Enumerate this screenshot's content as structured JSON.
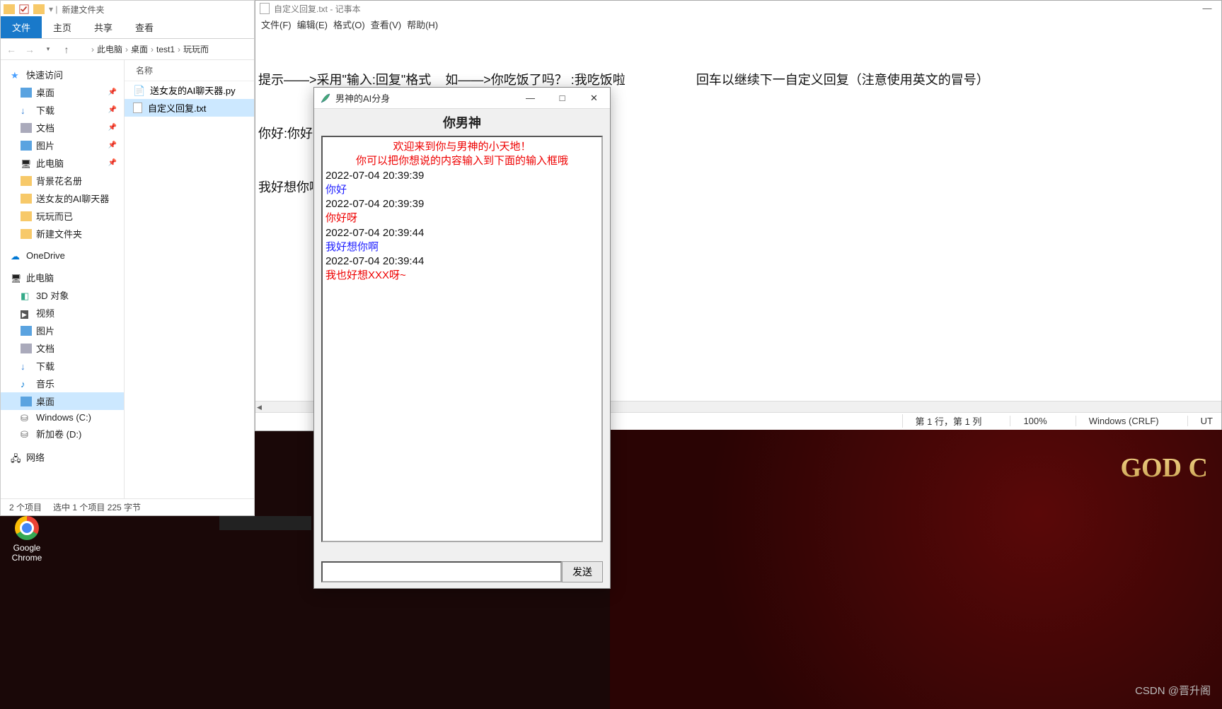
{
  "explorer": {
    "title": "新建文件夹",
    "tabs": {
      "file": "文件",
      "home": "主页",
      "share": "共享",
      "view": "查看"
    },
    "breadcrumb": [
      "此电脑",
      "桌面",
      "test1",
      "玩玩而"
    ],
    "columnHeader": "名称",
    "nav": {
      "quickAccess": "快速访问",
      "desktop": "桌面",
      "downloads": "下载",
      "documents": "文档",
      "pictures": "图片",
      "thisPC_pinned": "此电脑",
      "folder1": "背景花名册",
      "folder2": "送女友的AI聊天器",
      "folder3": "玩玩而已",
      "folder4": "新建文件夹",
      "onedrive": "OneDrive",
      "thisPC": "此电脑",
      "obj3d": "3D 对象",
      "videos": "视频",
      "pictures2": "图片",
      "documents2": "文档",
      "downloads2": "下载",
      "music": "音乐",
      "desktop2": "桌面",
      "driveC": "Windows (C:)",
      "driveD": "新加卷 (D:)",
      "network": "网络"
    },
    "files": [
      {
        "name": "送女友的AI聊天器.py",
        "icon": "py"
      },
      {
        "name": "自定义回复.txt",
        "icon": "txt",
        "selected": true
      }
    ],
    "status": {
      "count": "2 个项目",
      "selection": "选中 1 个项目  225 字节"
    }
  },
  "notepad": {
    "title": "自定义回复.txt - 记事本",
    "menu": {
      "file": "文件(F)",
      "edit": "编辑(E)",
      "format": "格式(O)",
      "view": "查看(V)",
      "help": "帮助(H)"
    },
    "lines": {
      "l1a": "提示——>采用\"输入:回复\"格式    如——>你吃饭了吗？ :我吃饭啦",
      "l1b": "回车以继续下一自定义回复（注意使用英文的冒号）",
      "l2": "你好:你好呀",
      "l3": "我好想你啊:我也好想XXX呀~"
    },
    "status": {
      "pos": "第 1 行，第 1 列",
      "zoom": "100%",
      "eol": "Windows (CRLF)",
      "enc": "UT"
    }
  },
  "tkapp": {
    "title": "男神的AI分身",
    "heading": "你男神",
    "welcome1": "欢迎来到你与男神的小天地！",
    "welcome2": "你可以把你想说的内容输入到下面的输入框哦",
    "messages": [
      {
        "ts": "2022-07-04 20:39:39",
        "who": "user",
        "text": "你好"
      },
      {
        "ts": "2022-07-04 20:39:39",
        "who": "bot",
        "text": "你好呀"
      },
      {
        "ts": "2022-07-04 20:39:44",
        "who": "user",
        "text": "我好想你啊"
      },
      {
        "ts": "2022-07-04 20:39:44",
        "who": "bot",
        "text": "我也好想XXX呀~"
      }
    ],
    "sendLabel": "发送"
  },
  "desktop": {
    "chrome": "Google\nChrome",
    "godText": "GOD C",
    "watermark": "CSDN @晋升阁"
  }
}
